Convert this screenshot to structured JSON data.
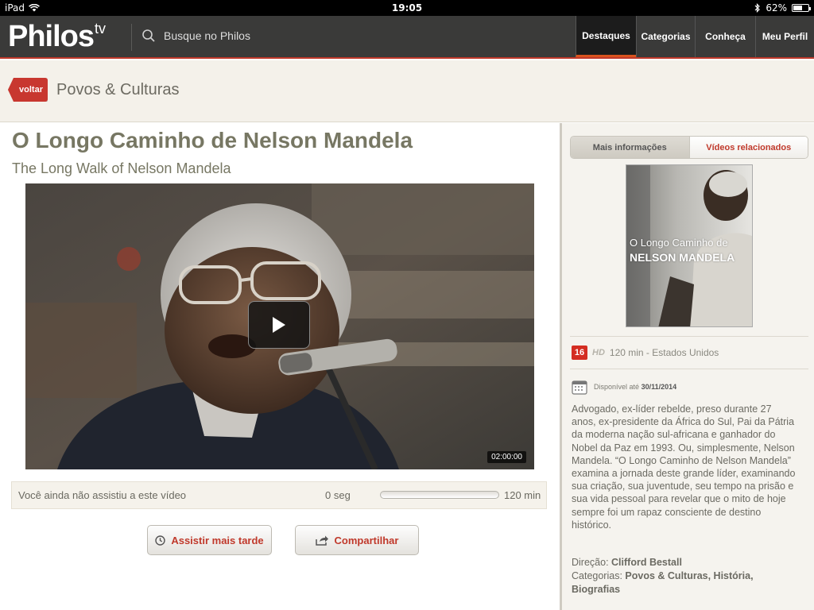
{
  "status_bar": {
    "device": "iPad",
    "time": "19:05",
    "battery": "62%",
    "battery_level": 0.62
  },
  "header": {
    "logo_main": "Philos",
    "logo_suffix": "tv",
    "search_placeholder": "Busque no Philos",
    "nav": [
      {
        "label": "Destaques",
        "active": true
      },
      {
        "label": "Categorias",
        "active": false
      },
      {
        "label": "Conheça",
        "active": false
      },
      {
        "label": "Meu Perfil",
        "active": false
      }
    ]
  },
  "breadcrumb": {
    "back_label": "voltar",
    "title": "Povos & Culturas"
  },
  "video": {
    "title": "O Longo Caminho de Nelson Mandela",
    "subtitle": "The Long Walk of Nelson Mandela",
    "duration_tag": "02:00:00",
    "watch_status": "Você ainda não assistiu a este vídeo",
    "progress_start": "0 seg",
    "progress_end": "120 min",
    "progress_fraction": 0,
    "watch_later_label": "Assistir mais tarde",
    "share_label": "Compartilhar"
  },
  "sidebar": {
    "tab_info": "Mais informações",
    "tab_related": "Vídeos relacionados",
    "poster_line1": "O Longo Caminho de",
    "poster_line2": "NELSON MANDELA",
    "age_rating": "16",
    "hd_badge": "HD",
    "meta": "120 min - Estados Unidos",
    "available_label": "Disponível até",
    "available_date": "30/11/2014",
    "description": "Advogado, ex-líder rebelde, preso durante 27 anos, ex-presidente da África do Sul, Pai da Pátria da moderna nação sul-africana e ganhador do Nobel da Paz em 1993. Ou, simplesmente, Nelson Mandela. “O Longo Caminho de Nelson Mandela” examina a jornada deste grande líder, examinando sua criação, sua juventude, seu tempo na prisão e sua vida pessoal para revelar que o mito de hoje sempre foi um rapaz consciente de destino histórico.",
    "director_label": "Direção:",
    "director": "Clifford Bestall",
    "categories_label": "Categorias:",
    "categories": "Povos & Culturas, História, Biografias"
  },
  "colors": {
    "accent": "#c8372f",
    "header_bg": "#3a3a39",
    "cream": "#f4f1ea"
  }
}
